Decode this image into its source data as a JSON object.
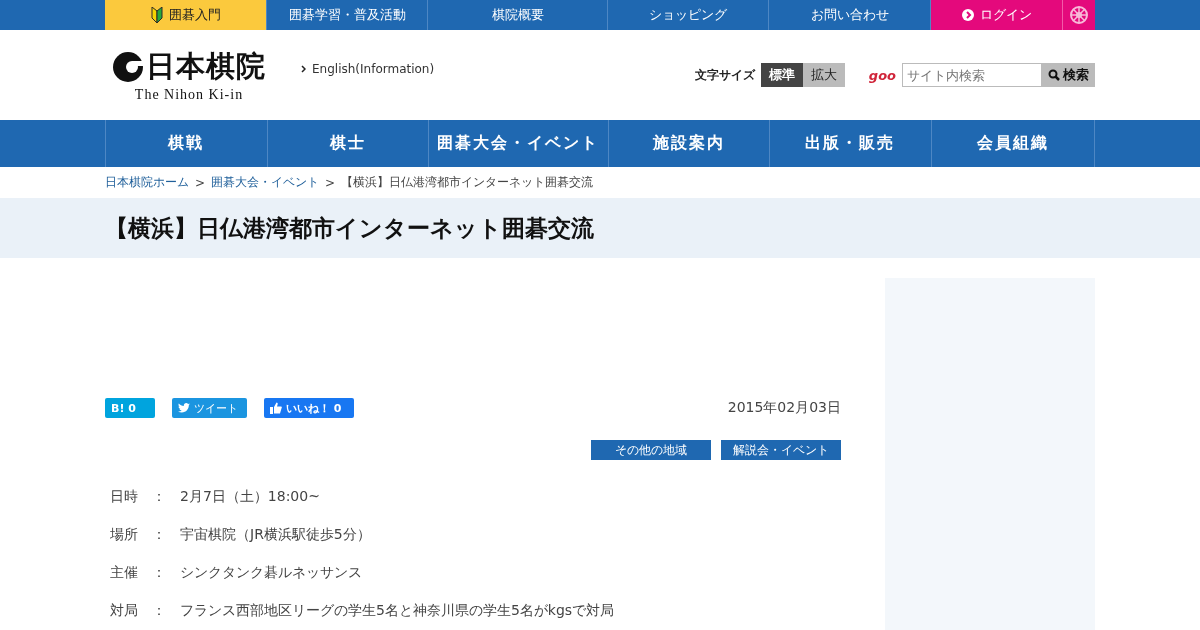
{
  "top_bar": [
    {
      "kind": "beginner",
      "label": "囲碁入門"
    },
    {
      "kind": "normal",
      "label": "囲碁学習・普及活動"
    },
    {
      "kind": "normal",
      "label": "棋院概要"
    },
    {
      "kind": "normal",
      "label": "ショッピング"
    },
    {
      "kind": "normal",
      "label": "お問い合わせ"
    },
    {
      "kind": "login",
      "label": "ログイン"
    },
    {
      "kind": "icon"
    }
  ],
  "header": {
    "logo_title": "日本棋院",
    "logo_subtitle": "The Nihon Ki-in",
    "english_link": "English(Information)",
    "font_size_label": "文字サイズ",
    "font_sizes": [
      {
        "label": "標準",
        "selected": true
      },
      {
        "label": "拡大",
        "selected": false
      }
    ],
    "search_brand": "goo",
    "search": {
      "placeholder": "サイト内検索"
    },
    "search_button": "検索"
  },
  "main_nav": [
    "棋戦",
    "棋士",
    "囲碁大会・イベント",
    "施設案内",
    "出版・販売",
    "会員組織"
  ],
  "breadcrumb": [
    {
      "label": "日本棋院ホーム",
      "link": true
    },
    {
      "label": "囲碁大会・イベント",
      "link": true
    },
    {
      "label": "【横浜】日仏港湾都市インターネット囲碁交流",
      "link": false
    }
  ],
  "breadcrumb_separator": ">",
  "page_title": "【横浜】日仏港湾都市インターネット囲碁交流",
  "share": [
    {
      "kind": "hatena",
      "label": "B!",
      "count": "0"
    },
    {
      "kind": "tweet",
      "label": "ツイート"
    },
    {
      "kind": "like",
      "label": "いいね！",
      "count": "0"
    }
  ],
  "date": "2015年02月03日",
  "tags": [
    "その他の地域",
    "解説会・イベント"
  ],
  "details": [
    {
      "label": "日時",
      "separator": "：",
      "value": "2月7日（土）18:00~"
    },
    {
      "label": "場所",
      "separator": "：",
      "value": "宇宙棋院（JR横浜駅徒歩5分）"
    },
    {
      "label": "主催",
      "separator": "：",
      "value": "シンクタンク碁ルネッサンス"
    },
    {
      "label": "対局",
      "separator": "：",
      "value": "フランス西部地区リーグの学生5名と神奈川県の学生5名がkgsで対局"
    }
  ]
}
